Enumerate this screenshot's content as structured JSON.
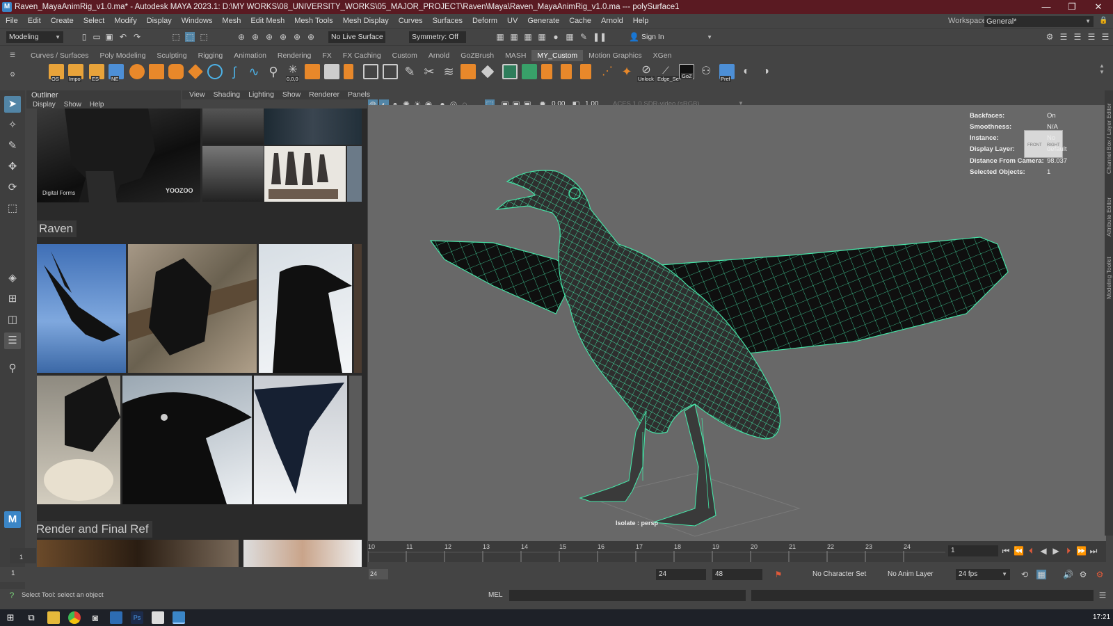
{
  "window": {
    "title": "Raven_MayaAnimRig_v1.0.ma* - Autodesk MAYA 2023.1: D:\\MY WORKS\\08_UNIVERSITY_WORKS\\05_MAJOR_PROJECT\\Raven\\Maya\\Raven_MayaAnimRig_v1.0.ma   ---   polySurface1",
    "app_icon": "M",
    "minimize": "—",
    "maximize": "❐",
    "close": "✕"
  },
  "menubar": {
    "items": [
      "File",
      "Edit",
      "Create",
      "Select",
      "Modify",
      "Display",
      "Windows",
      "Mesh",
      "Edit Mesh",
      "Mesh Tools",
      "Mesh Display",
      "Curves",
      "Surfaces",
      "Deform",
      "UV",
      "Generate",
      "Cache",
      "Arnold",
      "Help"
    ],
    "workspace_label": "Workspace:",
    "workspace_value": "General*"
  },
  "statusline": {
    "mode": "Modeling",
    "live_surface": "No Live Surface",
    "symmetry": "Symmetry: Off",
    "sign_in": "Sign In"
  },
  "shelf": {
    "tabs": [
      "Curves / Surfaces",
      "Poly Modeling",
      "Sculpting",
      "Rigging",
      "Animation",
      "Rendering",
      "FX",
      "FX Caching",
      "Custom",
      "Arnold",
      "GoZBrush",
      "MASH",
      "MY_Custom",
      "Motion Graphics",
      "XGen"
    ],
    "active_tab": "MY_Custom",
    "labels": {
      "os": "OS",
      "impo": "Impo",
      "es": "ES",
      "ne": "NE",
      "coords": "0,0,0",
      "unlock": "Unlock",
      "edge": "Edge_Se",
      "goz": "GoZ",
      "pref": "Pref"
    }
  },
  "outliner": {
    "title": "Outliner",
    "menu": [
      "Display",
      "Show",
      "Help"
    ]
  },
  "viewport_menu": [
    "View",
    "Shading",
    "Lighting",
    "Show",
    "Renderer",
    "Panels"
  ],
  "viewport_toolbar": {
    "exposure": "0.00",
    "gamma": "1.00",
    "color_space": "ACES 1.0 SDR-video (sRGB)"
  },
  "reference": {
    "watermark_left": "Digital Forms",
    "watermark_right": "YOOZOO",
    "section_raven": "Raven",
    "section_render": "Render and Final Ref"
  },
  "hud": {
    "rows": [
      {
        "label": "Backfaces:",
        "value": "On"
      },
      {
        "label": "Smoothness:",
        "value": "N/A"
      },
      {
        "label": "Instance:",
        "value": "No"
      },
      {
        "label": "Display Layer:",
        "value": "default"
      },
      {
        "label": "Distance From Camera:",
        "value": "98.037"
      },
      {
        "label": "Selected Objects:",
        "value": "1"
      }
    ],
    "isolate": "Isolate : persp",
    "cube_front": "FRONT",
    "cube_right": "RIGHT"
  },
  "timeline": {
    "ticks": [
      "10",
      "11",
      "12",
      "13",
      "14",
      "15",
      "16",
      "17",
      "18",
      "19",
      "20",
      "21",
      "22",
      "23",
      "24"
    ],
    "start_left": "1",
    "current_frame": "1"
  },
  "range": {
    "start": "1",
    "range_end": "24",
    "end": "24",
    "anim_end": "48",
    "character_set": "No Character Set",
    "anim_layer": "No Anim Layer",
    "fps": "24 fps"
  },
  "command": {
    "lang": "MEL",
    "help_line": "Select Tool: select an object"
  },
  "right_panel": {
    "channel_box": "Channel Box / Layer Editor",
    "attribute_editor": "Attribute Editor",
    "modeling_toolkit": "Modeling Toolkit"
  },
  "taskbar": {
    "time": "17:21"
  },
  "colors": {
    "wire": "#45e3a6",
    "titlebar": "#5a1a22",
    "active_tool": "#5285a6"
  }
}
